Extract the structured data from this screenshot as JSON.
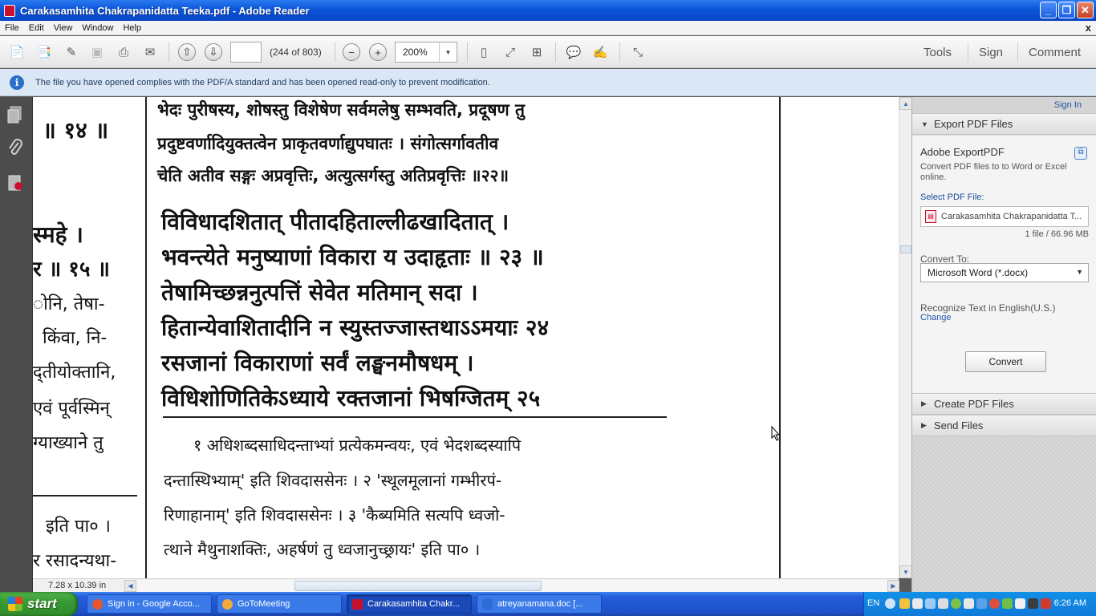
{
  "window": {
    "title": "Carakasamhita Chakrapanidatta Teeka.pdf - Adobe Reader",
    "min_label": "_",
    "max_label": "❐",
    "close_label": "✕"
  },
  "menu": {
    "items": [
      "File",
      "Edit",
      "View",
      "Window",
      "Help"
    ],
    "close_label": "x"
  },
  "toolbar": {
    "page_value": "",
    "page_count": "(244 of 803)",
    "zoom": "200%",
    "tools": "Tools",
    "sign": "Sign",
    "comment": "Comment"
  },
  "info": {
    "text": "The file you have opened complies with the PDF/A standard and has been opened read-only to prevent modification."
  },
  "document": {
    "left_col": [
      "॥ १४ ॥",
      "स्महे ।",
      "र ॥ १५ ॥",
      "ोनि, तेषा-",
      "किंवा, नि-",
      "द्तीयोक्तानि,",
      "एवं पूर्वस्मिन्",
      "ग्याख्याने तु",
      "इति पा० ।",
      "र रसादन्यथा-"
    ],
    "top_lines": [
      "भेदः पुरीषस्य, शोषस्तु विशेषेण सर्वमलेषु सम्भवति, प्रदूषण तु",
      "प्रदुष्टवर्णादियुक्तत्वेन प्राकृतवर्णाद्युपघातः । संगोत्सर्गावतीव",
      "चेति अतीव सङ्गः अप्रवृत्तिः, अत्युत्सर्गस्तु अतिप्रवृत्तिः ॥२२॥"
    ],
    "verse_lines": [
      "विविधादशितात् पीतादहिताल्लीढखादितात् ।",
      "भवन्त्येते मनुष्याणां विकारा य उदाहृताः ॥ २३ ॥",
      "तेषामिच्छन्ननुत्पत्तिं सेवेत मतिमान् सदा ।",
      "हितान्येवाशितादीनि न स्युस्तज्जास्तथाऽऽमयाः २४",
      "रसजानां विकाराणां सर्वं लङ्घनमौषधम् ।",
      "विधिशोणितिकेऽध्याये रक्तजानां भिषग्जितम् २५"
    ],
    "footnote_lines": [
      "१ अधिशब्दसाधिदन्ताभ्यां प्रत्येकमन्वयः, एवं भेदशब्दस्यापि",
      "दन्तास्थिभ्याम्' इति शिवदाससेनः । २ 'स्थूलमूलानां गम्भीरपं-",
      "रिणाहानाम्' इति शिवदाससेनः । ३ 'कैब्यमिति सत्यपि ध्वजो-",
      "त्थाने मैथुनाशक्तिः, अहर्षणं तु ध्वजानुच्छ्रायः' इति पा० ।"
    ]
  },
  "status": {
    "size": "7.28 x 10.39 in"
  },
  "right_pane": {
    "sign_in": "Sign In",
    "export_header": "Export PDF Files",
    "export_title": "Adobe ExportPDF",
    "export_desc": "Convert PDF files to to Word or Excel online.",
    "select_label": "Select PDF File:",
    "file_name": "Carakasamhita Chakrapanidatta T...",
    "file_info": "1 file / 66.96 MB",
    "convert_to_label": "Convert To:",
    "convert_to_value": "Microsoft Word (*.docx)",
    "recognize": "Recognize Text in English(U.S.)",
    "change": "Change",
    "convert_button": "Convert",
    "create_header": "Create PDF Files",
    "send_header": "Send Files"
  },
  "taskbar": {
    "start": "start",
    "tasks": [
      {
        "label": "Sign in - Google Acco...",
        "color": "#e4572e"
      },
      {
        "label": "GoToMeeting",
        "color": "#f2a93b"
      },
      {
        "label": "Carakasamhita Chakr...",
        "color": "#c8102e"
      },
      {
        "label": "atreyanamana.doc [...",
        "color": "#2f6bd6"
      }
    ],
    "lang": "EN",
    "clock": "6:26 AM"
  }
}
